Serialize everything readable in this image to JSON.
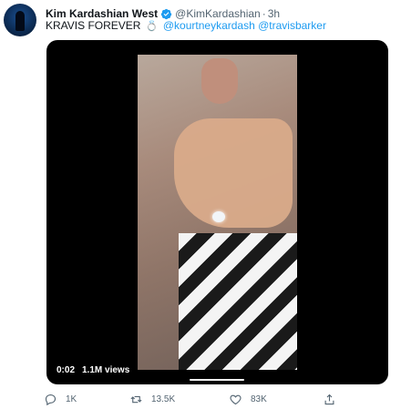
{
  "tweet": {
    "author_name": "Kim Kardashian West",
    "handle": "@KimKardashian",
    "separator": "·",
    "time": "3h",
    "text_prefix": "KRAVIS FOREVER",
    "ring_emoji": "💍",
    "mentions": [
      "@kourtneykardash",
      "@travisbarker"
    ]
  },
  "video": {
    "elapsed": "0:02",
    "views": "1.1M views",
    "progress_fraction": 0.02
  },
  "actions": {
    "reply_count": "1K",
    "retweet_count": "13.5K",
    "like_count": "83K"
  },
  "colors": {
    "accent": "#1d9bf0",
    "muted": "#536471",
    "text": "#0f1419"
  }
}
